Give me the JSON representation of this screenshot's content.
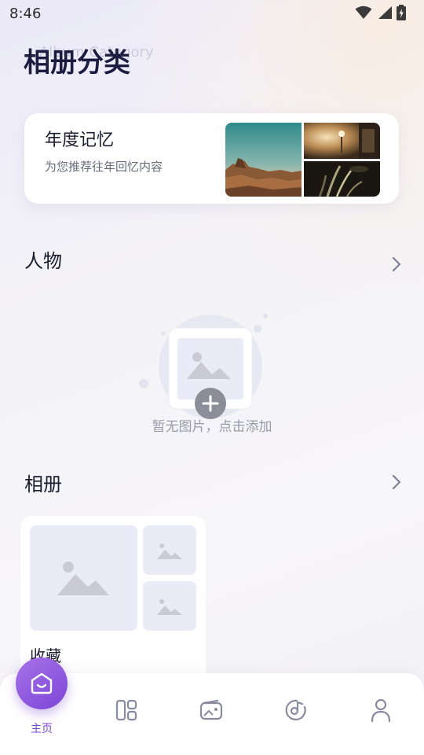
{
  "status_bar": {
    "time": "8:46",
    "icons": [
      "wifi-icon",
      "signal-icon",
      "battery-icon"
    ]
  },
  "header": {
    "title": "相册分类",
    "subtitle_watermark": "Album Category"
  },
  "memory_card": {
    "title": "年度记忆",
    "subtitle": "为您推荐往年回忆内容"
  },
  "people_section": {
    "title": "人物",
    "empty_text": "暂无图片，点击添加"
  },
  "albums_section": {
    "title": "相册",
    "albums": [
      {
        "name": "收藏"
      }
    ]
  },
  "bottom_nav": {
    "items": [
      {
        "label": "主页",
        "icon": "home-smile-icon",
        "active": true
      },
      {
        "label": "",
        "icon": "grid-layout-icon",
        "active": false
      },
      {
        "label": "",
        "icon": "wallet-photo-icon",
        "active": false
      },
      {
        "label": "",
        "icon": "disc-music-icon",
        "active": false
      },
      {
        "label": "",
        "icon": "person-icon",
        "active": false
      }
    ]
  },
  "colors": {
    "accent": "#7b45d6",
    "title": "#1c1c40",
    "placeholder_bg": "#e9ebf6"
  }
}
